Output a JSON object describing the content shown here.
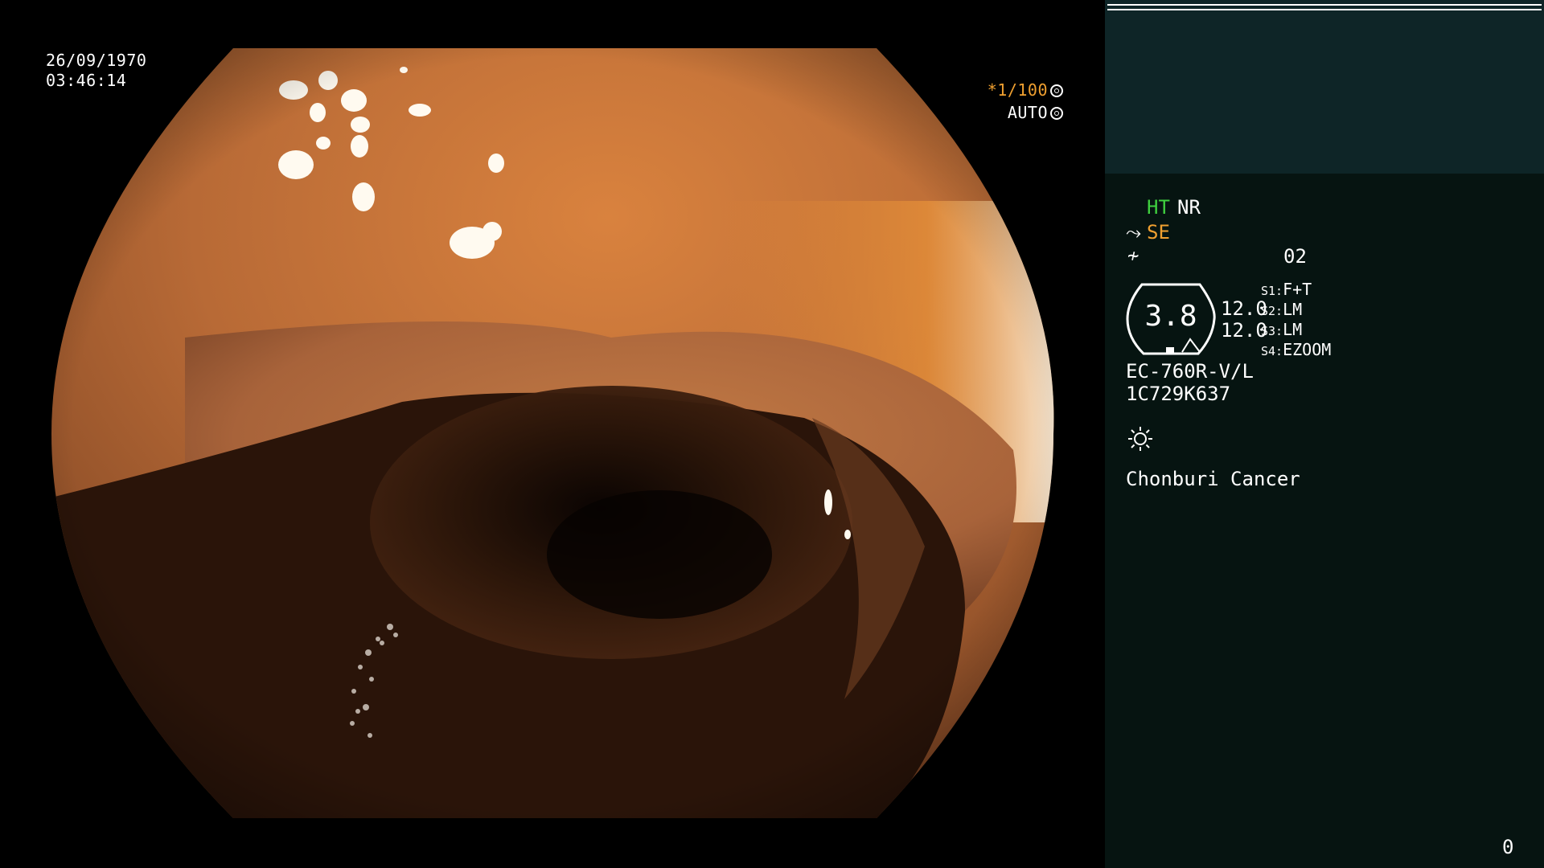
{
  "scope_view": {
    "date": "26/09/1970",
    "time": "03:46:14",
    "shutter_speed": "*1/100",
    "shutter_mode": "AUTO",
    "shutter_icon": "shutter-wheel-icon",
    "auto_icon": "iris-icon",
    "image_type": "endoscopic-colon-view"
  },
  "side_panel": {
    "mode_ht": "HT",
    "mode_nr": "NR",
    "mode_se": "SE",
    "mode_se_icon": "enhance-icon",
    "structure_icon": "structure-enhancement-icon",
    "memory_icon": "memory-card-icon",
    "memory_number": "02",
    "gauge_value": "3.8",
    "gauge_icon": "scope-gauge-icon",
    "level_1": "12.0",
    "level_2": "12.0",
    "switches": [
      {
        "key": "S1:",
        "value": "F+T"
      },
      {
        "key": "S2:",
        "value": "LM"
      },
      {
        "key": "S3:",
        "value": "LM"
      },
      {
        "key": "S4:",
        "value": "EZOOM"
      }
    ],
    "scope_model": "EC-760R-V/L",
    "serial_number": "1C729K637",
    "light_icon": "light-source-icon",
    "institution": "Chonburi Cancer",
    "page_counter": "0"
  },
  "colors": {
    "panel_bg": "#061411",
    "panel_top_bg": "#0e2527",
    "accent_green": "#3fd03f",
    "accent_orange": "#f0a030"
  }
}
